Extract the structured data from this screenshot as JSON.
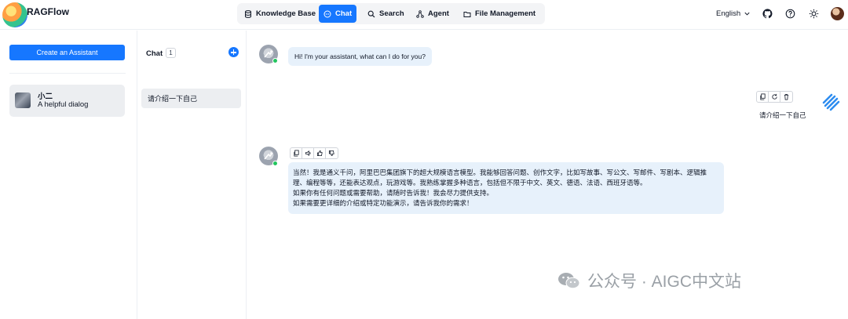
{
  "header": {
    "brand": "RAGFlow",
    "nav": [
      {
        "label": "Knowledge Base",
        "icon": "database-icon"
      },
      {
        "label": "Chat",
        "icon": "chat-bubble-icon",
        "active": true
      },
      {
        "label": "Search",
        "icon": "search-icon"
      },
      {
        "label": "Agent",
        "icon": "agent-icon"
      },
      {
        "label": "File Management",
        "icon": "folder-icon"
      }
    ],
    "language": "English",
    "icons": [
      "github-icon",
      "help-icon",
      "theme-sun-icon",
      "user-avatar"
    ]
  },
  "sidebar": {
    "create_button": "Create an Assistant",
    "assistants": [
      {
        "name": "小二",
        "description": "A helpful dialog"
      }
    ]
  },
  "chat_list": {
    "title": "Chat",
    "count": "1",
    "conversations": [
      {
        "title": "请介绍一下自己"
      }
    ]
  },
  "messages": [
    {
      "role": "assistant",
      "text": "Hi! I'm your assistant, what can I do for you?"
    },
    {
      "role": "user",
      "text": "请介绍一下自己"
    },
    {
      "role": "assistant",
      "lines": [
        "当然！我是通义千问，阿里巴巴集团旗下的超大规模语言模型。我能够回答问题、创作文字，比如写故事、写公文、写邮件、写剧本、逻辑推理、编程等等，还能表达观点，玩游戏等。我熟练掌握多种语言，包括但不限于中文、英文、德语、法语、西班牙语等。",
        "如果你有任何问题或需要帮助，请随时告诉我！我会尽力提供支持。",
        "如果需要更详细的介绍或特定功能演示，请告诉我你的需求！"
      ]
    }
  ],
  "watermark": {
    "text": "公众号 · AIGC中文站"
  },
  "colors": {
    "accent": "#1677ff",
    "bubble": "#e7f1fb",
    "online": "#22c55e"
  }
}
